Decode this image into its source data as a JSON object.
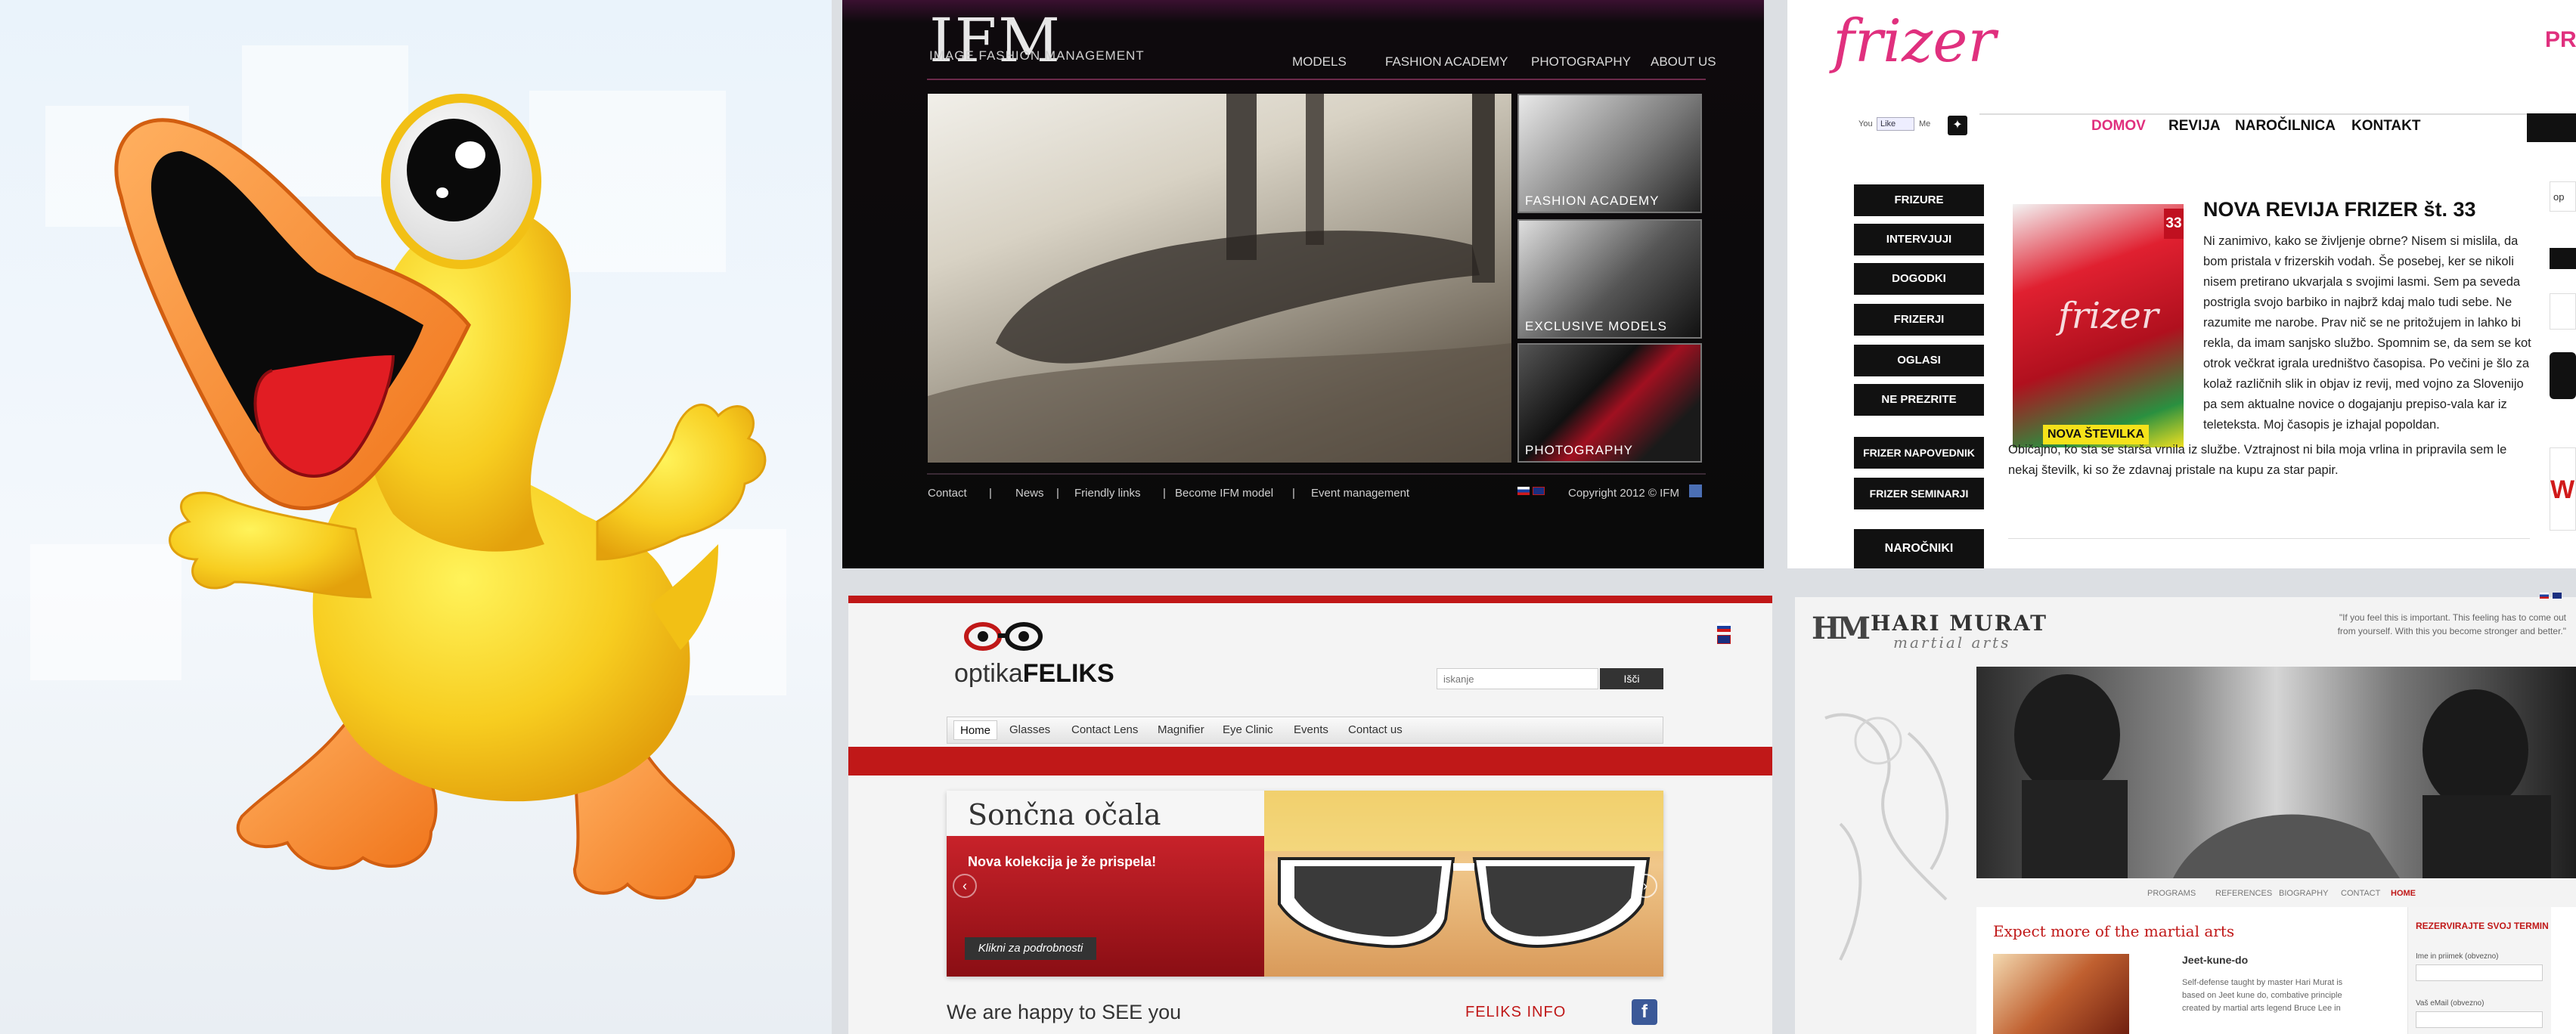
{
  "ifm": {
    "logo": "IFM",
    "subtitle": "IMAGE FASHION MANAGEMENT",
    "nav": [
      "MODELS",
      "FASHION ACADEMY",
      "PHOTOGRAPHY",
      "ABOUT US"
    ],
    "thumbs": [
      "FASHION ACADEMY",
      "EXCLUSIVE MODELS",
      "PHOTOGRAPHY"
    ],
    "footer_links": [
      "Contact",
      "News",
      "Friendly links",
      "Become IFM model",
      "Event management"
    ],
    "copyright": "Copyright 2012 © IFM"
  },
  "frizer": {
    "logo": "frizer",
    "nav": [
      "DOMOV",
      "REVIJA",
      "NAROČILNICA",
      "KONTAKT"
    ],
    "nav_active_color": "#e0307e",
    "social": {
      "you": "You",
      "like": "Like",
      "me": "Me"
    },
    "side_menu": [
      "FRIZURE",
      "INTERVJUJI",
      "DOGODKI",
      "FRIZERJI",
      "OGLASI",
      "NE PREZRITE",
      "FRIZER NAPOVEDNIK",
      "FRIZER SEMINARJI",
      "NAROČNIKI"
    ],
    "article_title": "NOVA REVIJA FRIZER št. 33",
    "article_text": "Ni zanimivo, kako se življenje obrne? Nisem si mislila, da bom pristala v frizerskih vodah. Še posebej, ker se nikoli nisem pretirano ukvarjala s svojimi lasmi. Sem pa seveda postrigla svojo barbiko in najbrž kdaj malo tudi sebe. Ne razumite me narobe. Prav nič se ne pritožujem in lahko bi rekla, da imam sanjsko službo. Spomnim se, da sem se kot otrok večkrat igrala uredništvo časopisa. Po večini je šlo za kolaž različnih slik in objav iz revij, med vojno za Slovenijo pa sem aktualne novice o dogajanju prepiso-vala kar iz teleteksta. Moj časopis je izhajal popoldan.",
    "article_text2": "Običajno, ko sta se starša vrnila iz službe. Vztrajnost ni bila moja vrlina in pripravila sem le nekaj številk, ki so že zdavnaj pristale na kupu za star papir.",
    "cover_number": "33",
    "cover_badge": "NOVA ŠTEVILKA",
    "right_edge_text": "PRO"
  },
  "optika": {
    "logo_light": "optika",
    "logo_bold": "FELIKS",
    "search_placeholder": "iskanje",
    "search_button": "Išči",
    "nav": [
      "Home",
      "Glasses",
      "Contact Lens",
      "Magnifier",
      "Eye Clinic",
      "Events",
      "Contact us"
    ],
    "slide_title": "Sončna očala",
    "slide_subtitle": "Nova kolekcija je že prispela!",
    "slide_button": "Klikni za podrobnosti",
    "welcome": "We are happy to SEE you",
    "info": "FELIKS INFO"
  },
  "hari": {
    "logo_mark": "HM",
    "logo_name": "HARI MURAT",
    "logo_tag": "martial arts",
    "quote": "\"If you feel this is important. This feeling has to come out from yourself. With this you become stronger and better.\"",
    "nav": [
      "PROGRAMS",
      "REFERENCES",
      "BIOGRAPHY",
      "CONTACT",
      "HOME"
    ],
    "heading": "Expect more of the martial arts",
    "item_title": "Jeet-kune-do",
    "item_text": "Self-defense taught by master Hari Murat is based on Jeet kune do, combative principle created by martial arts legend Bruce Lee in",
    "form_title": "REZERVIRAJTE SVOJ TERMIN",
    "form_name": "Ime in priimek (obvezno)",
    "form_email": "Vaš eMail (obvezno)"
  }
}
